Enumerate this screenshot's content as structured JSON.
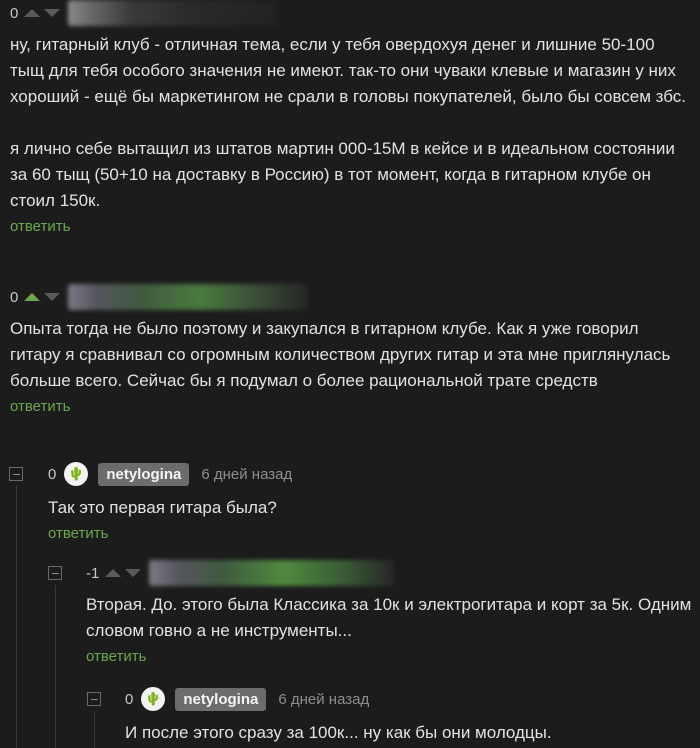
{
  "comments": [
    {
      "rating": "0",
      "text": "ну, гитарный клуб - отличная тема, если у тебя овердохуя денег и лишние 50-100 тыщ для тебя особого значения не имеют. так-то они чуваки клевые и магазин у них хороший - ещё бы маркетингом не срали в головы покупателей, было бы совсем збс.\n\nя лично себе вытащил из штатов мартин 000-15M в кейсе и в идеальном состоянии за 60 тыщ (50+10 на доставку в Россию) в тот момент, когда в гитарном клубе он стоил 150к.",
      "reply": "ответить"
    },
    {
      "rating": "0",
      "text": "Опыта тогда не было поэтому и закупался в гитарном клубе.  Как я уже говорил гитару я сравнивал со огромным количеством других гитар и эта мне приглянулась больше всего. Сейчас бы я подумал о более рациональной трате средств",
      "reply": "ответить"
    },
    {
      "rating": "0",
      "author": "netylogina",
      "time": "6 дней назад",
      "text": "Так это первая гитара была?",
      "reply": "ответить"
    },
    {
      "rating": "-1",
      "text": "Вторая. До. этого была Классика за 10к и электрогитара  и корт за 5к. Одним словом говно а не инструменты...",
      "reply": "ответить"
    },
    {
      "rating": "0",
      "author": "netylogina",
      "time": "6 дней назад",
      "text": "И после этого сразу за 100к... ну как бы они молодцы."
    }
  ],
  "icons": {
    "upvote": "upvote-icon",
    "downvote": "downvote-icon",
    "avatar": "cactus-avatar-icon",
    "collapse": "collapse-thread-icon"
  },
  "colors": {
    "background": "#1c1c1c",
    "reply_link": "#6aa84f",
    "nick_badge": "#6c6c6c"
  }
}
